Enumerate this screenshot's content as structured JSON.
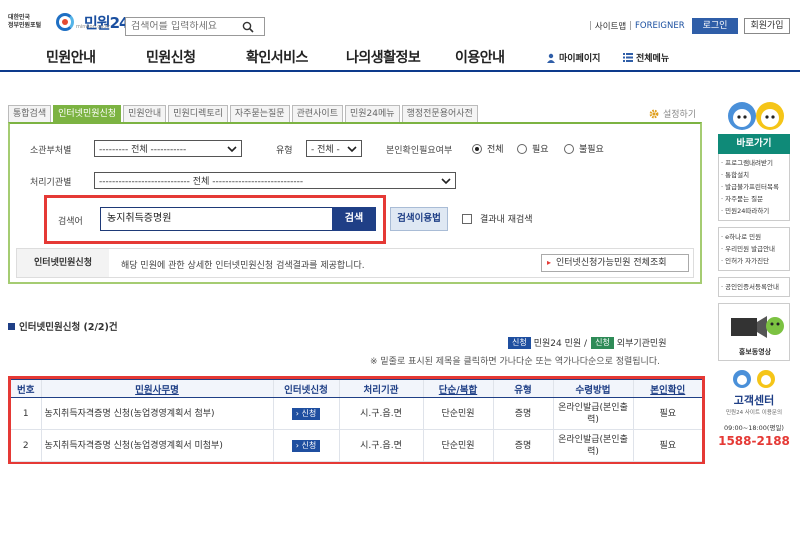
{
  "header": {
    "logo_gov": "대한민국\n정부민원포털",
    "logo_text": "민원24",
    "logo_sub": "minwon.go.kr",
    "search_placeholder": "검색어를 입력하세요",
    "sitemap": "사이트맵",
    "foreigner": "FOREIGNER",
    "login": "로그인",
    "join": "회원가입"
  },
  "gnb": {
    "items": [
      "민원안내",
      "민원신청",
      "확인서비스",
      "나의생활정보",
      "이용안내"
    ],
    "mypage": "마이페이지",
    "all_menu": "전체메뉴"
  },
  "tabs": [
    "통합검색",
    "인터넷민원신청",
    "민원안내",
    "민원디렉토리",
    "자주묻는질문",
    "관련사이트",
    "민원24메뉴",
    "행정전문용어사전"
  ],
  "active_tab": 1,
  "setting_label": "설정하기",
  "search_form": {
    "dept_label": "소관부처별",
    "dept_value": "--------- 전체 -----------",
    "type_label": "유형",
    "type_value": "- 전체 -",
    "auth_label": "본인확인필요여부",
    "auth_options": [
      "전체",
      "필요",
      "불필요"
    ],
    "auth_selected": 0,
    "org_label": "처리기관별",
    "org_value": "---------------------------- 전체 ----------------------------",
    "kw_label": "검색어",
    "kw_value": "농지취득증명원",
    "search_btn": "검색",
    "help_btn": "검색이용법",
    "research_label": "결과내 재검색"
  },
  "info_bar": {
    "title": "인터넷민원신청",
    "text": "해당 민원에 관한 상세한 인터넷민원신청 검색결과를 제공합니다.",
    "button": "인터넷신청가능민원 전체조회"
  },
  "results": {
    "title": "인터넷민원신청 (2/2)건",
    "legend_badge1": "신청",
    "legend_text1": "민원24 민원 /",
    "legend_badge2": "신청",
    "legend_text2": "외부기관민원",
    "notice": "※ 밑줄로 표시된 제목을 클릭하면 가나다순 또는 역가나다순으로 정렬됩니다.",
    "headers": [
      "번호",
      "민원사무명",
      "인터넷신청",
      "처리기관",
      "단순/복합",
      "유형",
      "수령방법",
      "본인확인"
    ],
    "rows": [
      {
        "no": "1",
        "name": "농지취득자격증명 신청(농업경영계획서 첨부)",
        "apply": "신청",
        "org": "시.구.읍.면",
        "kind": "단순민원",
        "type": "증명",
        "receive": "온라인발급(본인출력)",
        "auth": "필요"
      },
      {
        "no": "2",
        "name": "농지취득자격증명 신청(농업경영계획서 미첨부)",
        "apply": "신청",
        "org": "시.구.읍.면",
        "kind": "단순민원",
        "type": "증명",
        "receive": "온라인발급(본인출력)",
        "auth": "필요"
      }
    ]
  },
  "sidebar": {
    "title": "바로가기",
    "links": [
      "· 프로그램내려받기",
      "· 통합설치",
      "· 발급불가프린터목록",
      "· 자주묻는 질문",
      "· 민원24따라하기"
    ],
    "links2": [
      "· e하나로 민원",
      "· 우리민원 발급안내",
      "· 인허가 자가진단"
    ],
    "links3": [
      "· 공인인증서등록안내"
    ],
    "video": "홍보동영상",
    "cs_title": "고객센터",
    "cs_sub": "민원24 사이트 이용문의",
    "cs_hours": "09:00~18:00(평일)",
    "cs_phone": "1588-2188"
  },
  "colors": {
    "brand": "#1f3f86",
    "tab_active": "#7cb342",
    "highlight": "#e53935",
    "sidebar": "#0f8a78"
  }
}
